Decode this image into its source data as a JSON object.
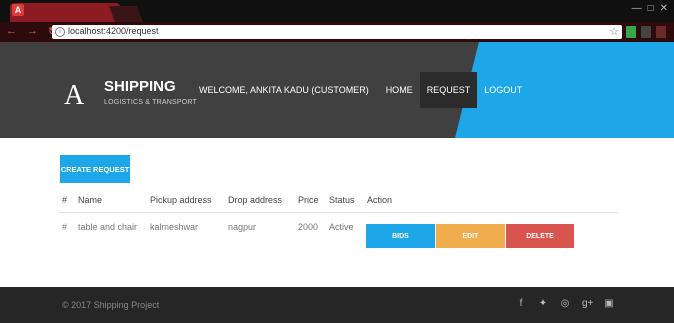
{
  "browser": {
    "tab_logo": "A",
    "url": "localhost:4200/request",
    "window_controls": [
      "—",
      "□",
      "✕"
    ]
  },
  "header": {
    "logo_letter": "A",
    "brand_name": "SHIPPING",
    "brand_tagline": "LOGISTICS & TRANSPORT",
    "welcome": "WELCOME, ANKITA KADU (CUSTOMER)",
    "nav": [
      {
        "label": "HOME",
        "active": false
      },
      {
        "label": "REQUEST",
        "active": true
      },
      {
        "label": "LOGOUT",
        "active": false
      }
    ],
    "accent_color": "#1ea7e8"
  },
  "main": {
    "create_button": "CREATE REQUEST",
    "table": {
      "columns": [
        "#",
        "Name",
        "Pickup address",
        "Drop address",
        "Price",
        "Status",
        "Action"
      ],
      "rows": [
        {
          "index": "#",
          "name": "table and chair",
          "pickup": "kalmeshwar",
          "drop": "nagpur",
          "price": "2000",
          "status": "Active"
        }
      ],
      "actions": [
        "BIDS",
        "EDIT",
        "DELETE"
      ]
    }
  },
  "footer": {
    "copyright": "© 2017 Shipping Project",
    "social_icons": [
      "facebook-icon",
      "twitter-icon",
      "dribbble-icon",
      "google-plus-icon",
      "instagram-icon"
    ]
  }
}
